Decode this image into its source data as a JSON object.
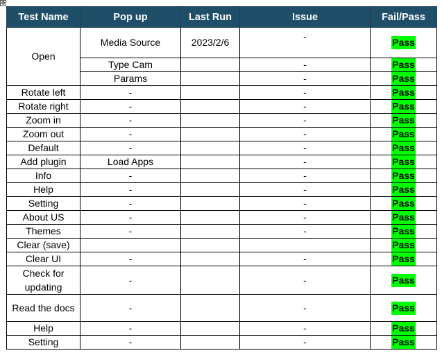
{
  "columns": [
    "Test Name",
    "Pop up",
    "Last Run",
    "Issue",
    "Fail/Pass"
  ],
  "open_group": {
    "test_name": "Open",
    "rows": [
      {
        "popup": "Media Source",
        "last_run": "2023/2/6",
        "issue": "-",
        "result": "Pass"
      },
      {
        "popup": "Type Cam",
        "last_run": "",
        "issue": "-",
        "result": "Pass"
      },
      {
        "popup": "Params",
        "last_run": "",
        "issue": "-",
        "result": "Pass"
      }
    ]
  },
  "rows": [
    {
      "test_name": "Rotate left",
      "popup": "-",
      "last_run": "",
      "issue": "-",
      "result": "Pass"
    },
    {
      "test_name": "Rotate right",
      "popup": "-",
      "last_run": "",
      "issue": "-",
      "result": "Pass"
    },
    {
      "test_name": "Zoom in",
      "popup": "-",
      "last_run": "",
      "issue": "-",
      "result": "Pass"
    },
    {
      "test_name": "Zoom out",
      "popup": "-",
      "last_run": "",
      "issue": "-",
      "result": "Pass"
    },
    {
      "test_name": "Default",
      "popup": "-",
      "last_run": "",
      "issue": "-",
      "result": "Pass"
    },
    {
      "test_name": "Add plugin",
      "popup": "Load Apps",
      "last_run": "",
      "issue": "-",
      "result": "Pass"
    },
    {
      "test_name": "Info",
      "popup": "-",
      "last_run": "",
      "issue": "-",
      "result": "Pass"
    },
    {
      "test_name": "Help",
      "popup": "-",
      "last_run": "",
      "issue": "-",
      "result": "Pass"
    },
    {
      "test_name": "Setting",
      "popup": "-",
      "last_run": "",
      "issue": "-",
      "result": "Pass"
    },
    {
      "test_name": "About US",
      "popup": "-",
      "last_run": "",
      "issue": "-",
      "result": "Pass"
    },
    {
      "test_name": "Themes",
      "popup": "-",
      "last_run": "",
      "issue": "-",
      "result": "Pass"
    },
    {
      "test_name": "Clear (save)",
      "popup": "",
      "last_run": "",
      "issue": "",
      "result": "Pass"
    },
    {
      "test_name": "Clear UI",
      "popup": "-",
      "last_run": "",
      "issue": "-",
      "result": "Pass"
    },
    {
      "test_name": "Check for updating",
      "popup": "-",
      "last_run": "",
      "issue": "-",
      "result": "Pass",
      "tall": true
    },
    {
      "test_name": "Read the docs",
      "popup": "-",
      "last_run": "",
      "issue": "-",
      "result": "Pass",
      "tall": true
    },
    {
      "test_name": "Help",
      "popup": "-",
      "last_run": "",
      "issue": "-",
      "result": "Pass"
    },
    {
      "test_name": "Setting",
      "popup": "-",
      "last_run": "",
      "issue": "-",
      "result": "Pass"
    }
  ],
  "colors": {
    "header_bg": "#1f4e69",
    "header_text": "#ffffff",
    "pass_highlight": "#00ff00"
  }
}
